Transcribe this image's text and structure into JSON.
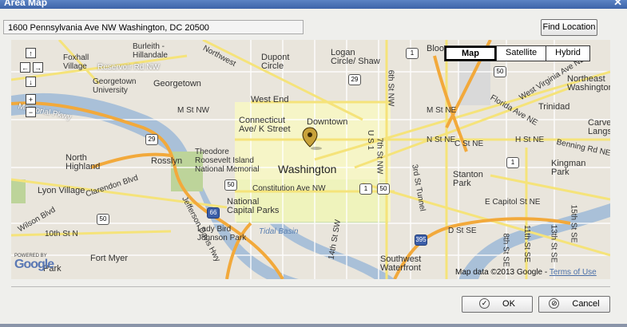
{
  "window": {
    "title": "Area Map",
    "close_symbol": "✕"
  },
  "address": {
    "value": "1600 Pennsylvania Ave NW  Washington, DC 20500"
  },
  "buttons": {
    "find_location": "Find Location",
    "ok": "OK",
    "cancel": "Cancel"
  },
  "map": {
    "types": [
      "Map",
      "Satellite",
      "Hybrid"
    ],
    "selected_type": "Map",
    "nav": {
      "up": "↑",
      "left": "←",
      "right": "→",
      "down": "↓",
      "zoom_in": "+",
      "zoom_out": "−"
    },
    "labels": {
      "foxhall_village": "Foxhall\nVillage",
      "burleith": "Burleith -\nHillandale",
      "reservoir_rd": "Reservoir Rd NW",
      "georgetown_univ": "Georgetown\nUniversity",
      "georgetown": "Georgetown",
      "dupont": "Dupont\nCircle",
      "logan": "Logan\nCircle/ Shaw",
      "northeast": "Northeast\nWashington",
      "west_end": "West End",
      "connecticut": "Connecticut\nAve/ K Street",
      "downtown": "Downtown",
      "washington": "Washington",
      "north_highland": "North\nHighland",
      "rosslyn": "Rosslyn",
      "theodore": "Theodore\nRoosevelt Island\nNational Memorial",
      "lyon_village": "Lyon Village",
      "constitution": "Constitution Ave NW",
      "national_capital_parks": "National\nCapital Parks",
      "lady_bird": "Lady Bird\nJohnson Park",
      "tidal_basin": "Tidal Basin",
      "fort_myer": "Fort Myer",
      "southwest": "Southwest\nWaterfront",
      "trinidad": "Trinidad",
      "stanton_park": "Stanton\nPark",
      "kingman_park": "Kingman\nPark",
      "carver": "Carve\nLangst",
      "m_st_nw": "M St NW",
      "m_st_ne": "M St NE",
      "h_st_ne": "H St NE",
      "n_st_ne": "N St NE",
      "c_st_ne": "C St NE",
      "d_st_se": "D St SE",
      "e_capitol": "E Capitol St NE",
      "florida": "Florida Ave NE",
      "benning": "Benning Rd NE",
      "west_virginia": "West Virginia Ave NE",
      "memorial_pkwy": "Memorial Pkwy",
      "clarendon": "Clarendon Blvd",
      "wilson": "Wilson Blvd",
      "tenth_st_n": "10th St N",
      "jefferson": "Jefferson Davis Hwy",
      "fourteenth_st_sw": "14th St SW",
      "sixth_st_nw": "6th St NW",
      "seventh_st_nw": "7th St NW",
      "third_st_tunnel": "3rd St Tunnel",
      "us1": "U S 1",
      "eighth_st_se": "8th St SE",
      "eleventh_st_se": "11th St SE",
      "thirteenth_st_se": "13th St SE",
      "fifteenth_st_se": "15th St SE",
      "northwest": "Northwest",
      "blo": "Bloo",
      "park": "Park",
      "powered_by": "POWERED BY",
      "google": "Google",
      "attribution": "Map data ©2013 Google - ",
      "terms": "Terms of Use"
    },
    "shields": [
      "1",
      "29",
      "50",
      "50",
      "29",
      "66",
      "50",
      "1",
      "395",
      "1",
      "50"
    ]
  }
}
